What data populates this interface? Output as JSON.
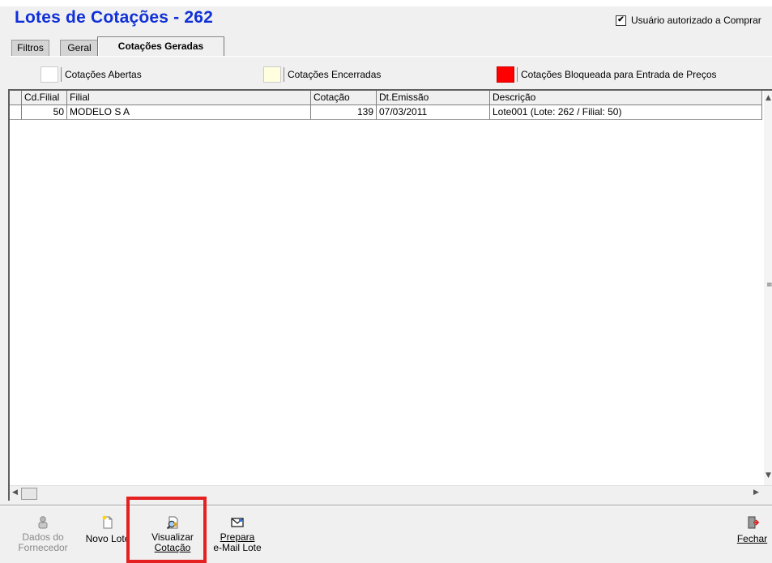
{
  "window": {
    "title": "Lotes de Cotações - 262"
  },
  "authorized": {
    "label": "Usuário autorizado a Comprar",
    "checked": true,
    "mark": "✔"
  },
  "tabs": [
    {
      "label": "Filtros",
      "active": false
    },
    {
      "label": "Geral",
      "active": false
    },
    {
      "label": "Cotações Geradas",
      "active": true
    }
  ],
  "legend": [
    {
      "label": "Cotações Abertas",
      "color": "#ffffff"
    },
    {
      "label": "Cotações Encerradas",
      "color": "#ffffe0"
    },
    {
      "label": "Cotações Bloqueada para Entrada de Preços",
      "color": "#ff0000"
    }
  ],
  "grid": {
    "columns": [
      "Cd.Filial",
      "Filial",
      "Cotação",
      "Dt.Emissão",
      "Descrição"
    ],
    "rows": [
      {
        "cd_filial": "50",
        "filial": "MODELO S A",
        "cotacao": "139",
        "dt_emissao": "07/03/2011",
        "descricao": "Lote001 (Lote: 262 / Filial: 50)"
      }
    ]
  },
  "toolbar": {
    "dados_fornecedor": {
      "line1": "Dados do",
      "line2": "Fornecedor",
      "enabled": false,
      "icon": "supplier-data-icon"
    },
    "novo_lote": {
      "label": "Novo Lote",
      "icon": "new-document-icon"
    },
    "visualizar_cotacao": {
      "line1": "Visualizar",
      "line2": "Cotação",
      "icon": "view-document-icon"
    },
    "prepara_email": {
      "line1": "Prepara",
      "line2": "e-Mail Lote",
      "icon": "email-envelope-icon"
    },
    "fechar": {
      "label": "Fechar",
      "icon": "exit-door-icon"
    }
  },
  "highlight": {
    "color": "#e52020",
    "target": "visualizar_cotacao"
  }
}
